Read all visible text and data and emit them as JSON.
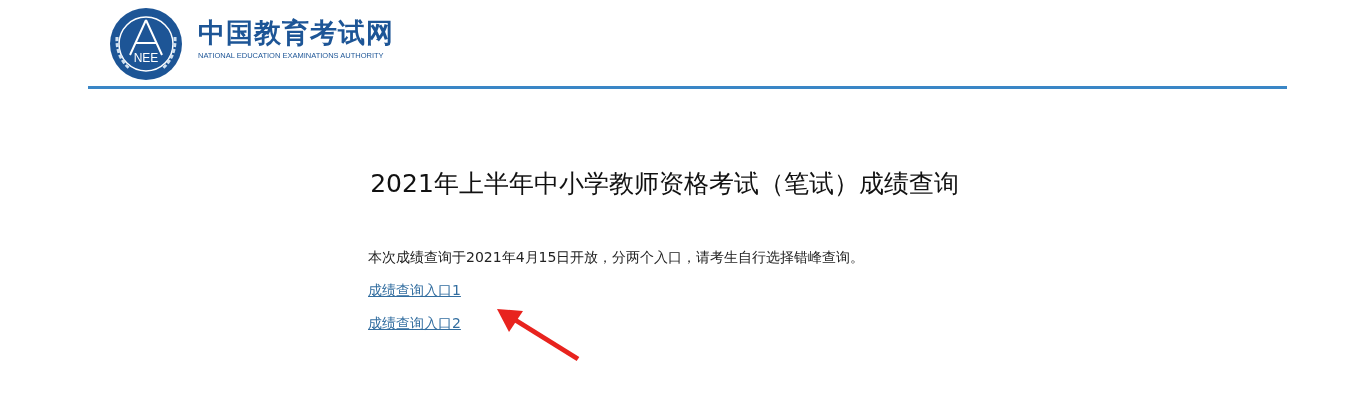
{
  "header": {
    "logo_letters": "NEE",
    "site_name": "中国教育考试网",
    "site_name_en": "NATIONAL EDUCATION EXAMINATIONS AUTHORITY"
  },
  "page_title": "2021年上半年中小学教师资格考试（笔试）成绩查询",
  "notice": "本次成绩查询于2021年4月15日开放，分两个入口，请考生自行选择错峰查询。",
  "links": [
    {
      "label": "成绩查询入口1"
    },
    {
      "label": "成绩查询入口2"
    }
  ]
}
